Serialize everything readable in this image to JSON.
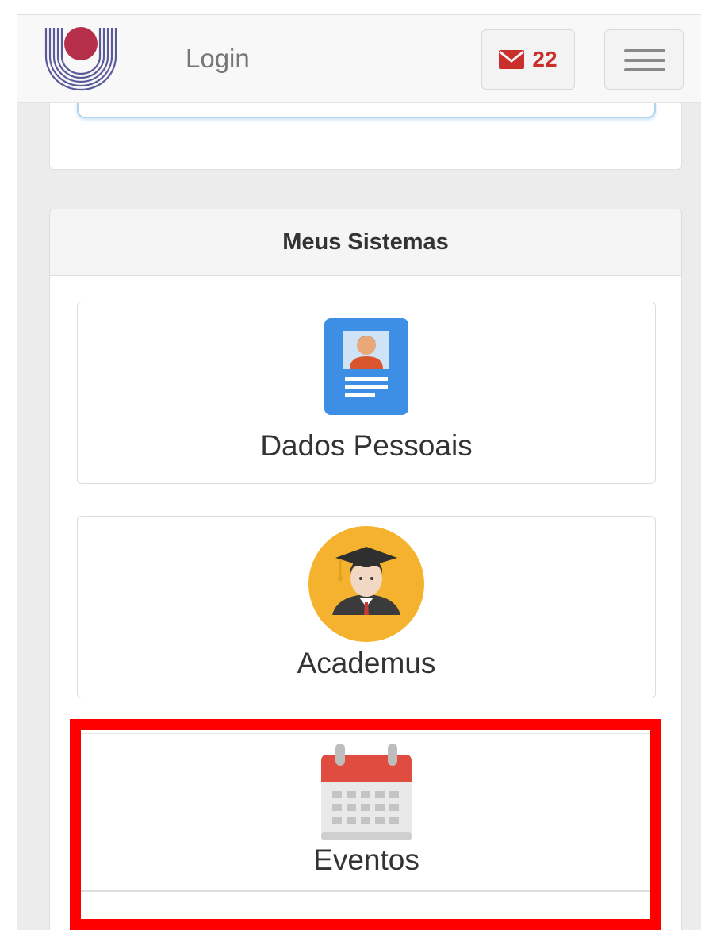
{
  "navbar": {
    "logo_name": "university-logo",
    "login_label": "Login",
    "messages": {
      "icon": "envelope-icon",
      "count": "22"
    },
    "menu_icon": "hamburger-icon"
  },
  "systems": {
    "heading": "Meus Sistemas",
    "items": [
      {
        "label": "Dados Pessoais",
        "icon": "personal-id-card-icon"
      },
      {
        "label": "Academus",
        "icon": "graduate-avatar-icon"
      },
      {
        "label": "Eventos",
        "icon": "calendar-icon"
      }
    ]
  },
  "colors": {
    "highlight": "#ff0000",
    "badge_red": "#c9302c",
    "logo_red": "#b52f4a",
    "logo_stripes": "#5a5a9a"
  }
}
